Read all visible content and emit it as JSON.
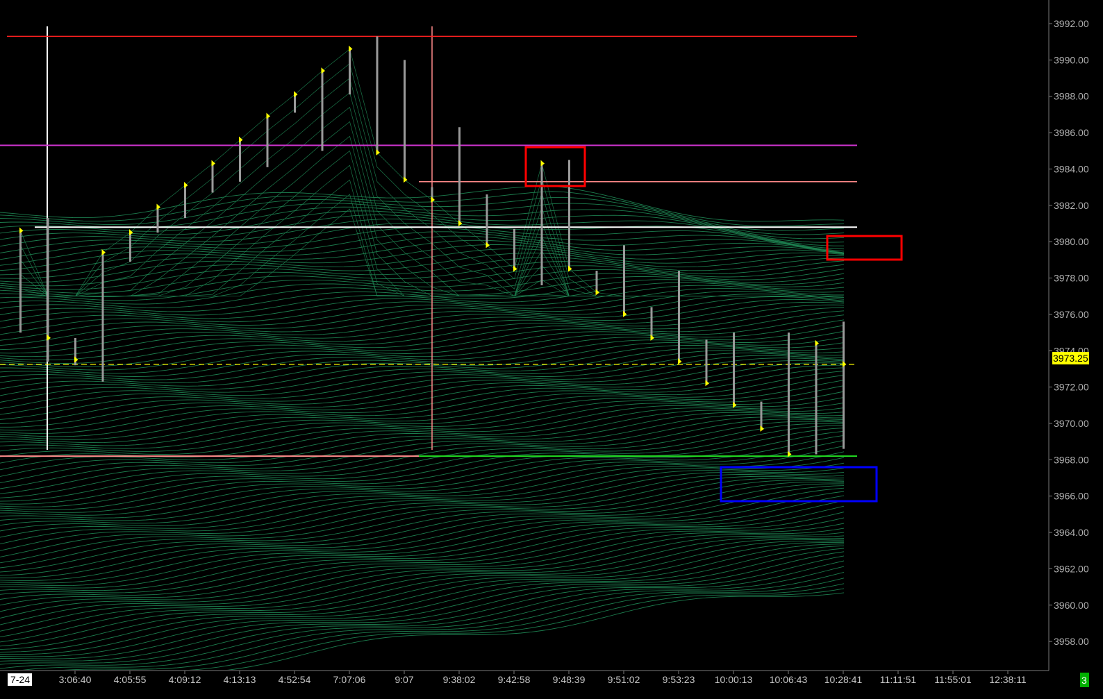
{
  "chart_data": {
    "type": "bar",
    "title": "",
    "xlabel": "",
    "ylabel": "",
    "ylim": [
      3956.4,
      3993.3
    ],
    "y_ticks": [
      "3992.00",
      "3990.00",
      "3988.00",
      "3986.00",
      "3984.00",
      "3982.00",
      "3980.00",
      "3978.00",
      "3976.00",
      "3974.00",
      "3972.00",
      "3970.00",
      "3968.00",
      "3966.00",
      "3964.00",
      "3962.00",
      "3960.00",
      "3958.00"
    ],
    "x_ticks": [
      "7-24",
      "3:06:40",
      "4:05:55",
      "4:09:12",
      "4:13:13",
      "4:52:54",
      "7:07:06",
      "9:07",
      "9:38:02",
      "9:42:58",
      "9:48:39",
      "9:51:02",
      "9:53:23",
      "10:00:13",
      "10:06:43",
      "10:28:41",
      "11:11:51",
      "11:55:01",
      "12:38:11"
    ],
    "last_price_label": "3973.25",
    "corner_badge": "3",
    "grid": false,
    "colors": {
      "background": "#000000",
      "bars": "#9a9a9a",
      "close_ticks": "#ffff00",
      "ribbon": "#1f8a55",
      "last_price": "#ffff00",
      "resistance": "#ff2020",
      "magenta_level": "#cc33cc",
      "pink_level": "#ff8a8a",
      "white_level": "#ffffff",
      "support": "#22dd22",
      "box_red": "#ff0000",
      "box_blue": "#0000ff",
      "badge": "#00aa00"
    },
    "levels": [
      {
        "kind": "resistance",
        "value": 3991.3
      },
      {
        "kind": "magenta",
        "value": 3985.3
      },
      {
        "kind": "pink",
        "value": 3983.3
      },
      {
        "kind": "white",
        "value": 3980.8
      },
      {
        "kind": "last_price",
        "value": 3973.25
      },
      {
        "kind": "support",
        "value": 3968.2
      }
    ],
    "bars": [
      {
        "high": 3980.6,
        "low": 3975.0,
        "close": 3980.6
      },
      {
        "high": 3981.3,
        "low": 3973.4,
        "close": 3974.7
      },
      {
        "high": 3974.7,
        "low": 3973.2,
        "close": 3973.5
      },
      {
        "high": 3979.4,
        "low": 3972.3,
        "close": 3979.4
      },
      {
        "high": 3980.5,
        "low": 3978.9,
        "close": 3980.5
      },
      {
        "high": 3981.9,
        "low": 3980.5,
        "close": 3981.9
      },
      {
        "high": 3983.1,
        "low": 3981.3,
        "close": 3983.1
      },
      {
        "high": 3984.3,
        "low": 3982.7,
        "close": 3984.3
      },
      {
        "high": 3985.6,
        "low": 3983.3,
        "close": 3985.6
      },
      {
        "high": 3986.9,
        "low": 3984.1,
        "close": 3986.9
      },
      {
        "high": 3988.1,
        "low": 3987.1,
        "close": 3988.1
      },
      {
        "high": 3989.4,
        "low": 3985.0,
        "close": 3989.4
      },
      {
        "high": 3990.6,
        "low": 3988.1,
        "close": 3990.6
      },
      {
        "high": 3991.3,
        "low": 3984.9,
        "close": 3984.9
      },
      {
        "high": 3990.0,
        "low": 3983.4,
        "close": 3983.4
      },
      {
        "high": 3983.0,
        "low": 3982.3,
        "close": 3982.3
      },
      {
        "high": 3986.3,
        "low": 3981.0,
        "close": 3981.0
      },
      {
        "high": 3982.6,
        "low": 3979.8,
        "close": 3979.8
      },
      {
        "high": 3980.7,
        "low": 3978.5,
        "close": 3978.5
      },
      {
        "high": 3984.3,
        "low": 3977.6,
        "close": 3984.3
      },
      {
        "high": 3984.5,
        "low": 3978.5,
        "close": 3978.5
      },
      {
        "high": 3978.4,
        "low": 3977.2,
        "close": 3977.2
      },
      {
        "high": 3979.8,
        "low": 3976.0,
        "close": 3976.0
      },
      {
        "high": 3976.4,
        "low": 3974.7,
        "close": 3974.7
      },
      {
        "high": 3978.4,
        "low": 3973.4,
        "close": 3973.4
      },
      {
        "high": 3974.6,
        "low": 3972.2,
        "close": 3972.2
      },
      {
        "high": 3975.0,
        "low": 3971.0,
        "close": 3971.0
      },
      {
        "high": 3971.2,
        "low": 3969.7,
        "close": 3969.7
      },
      {
        "high": 3975.0,
        "low": 3968.3,
        "close": 3968.3
      },
      {
        "high": 3974.4,
        "low": 3968.3,
        "close": 3974.4
      },
      {
        "high": 3975.6,
        "low": 3968.6,
        "close": 3973.25
      }
    ]
  }
}
